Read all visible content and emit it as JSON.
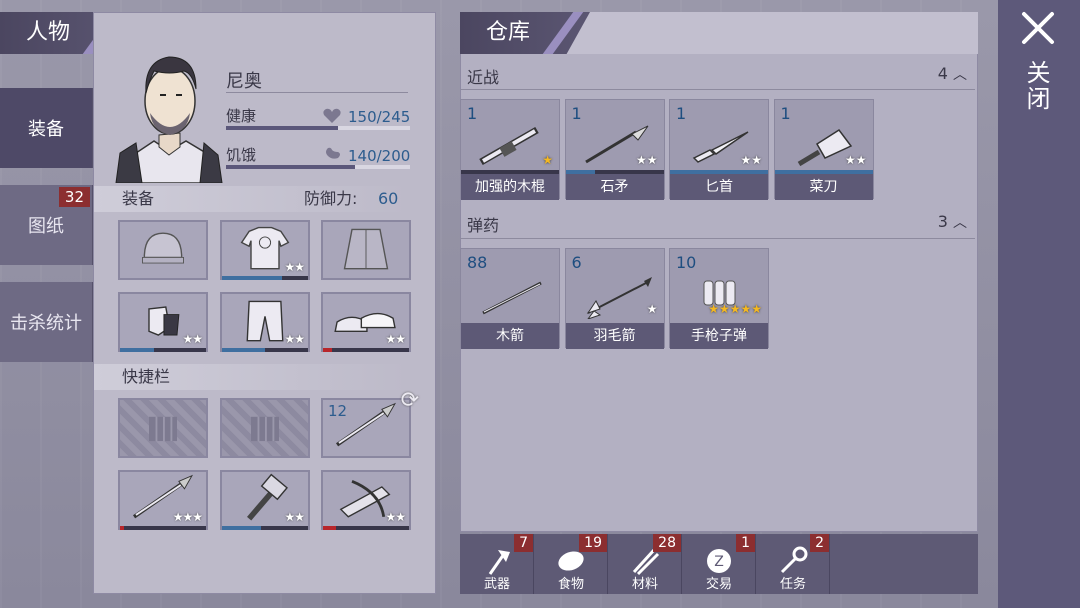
{
  "left_nav": {
    "title": "人物",
    "items": [
      {
        "label": "装备",
        "active": true
      },
      {
        "label": "图纸",
        "badge": "32"
      },
      {
        "label": "击杀统计"
      }
    ]
  },
  "character": {
    "name": "尼奥",
    "health_label": "健康",
    "health_value": "150/245",
    "health_fraction": 0.61,
    "hunger_label": "饥饿",
    "hunger_value": "140/200",
    "hunger_fraction": 0.7,
    "equipment_label": "装备",
    "defense_label": "防御力:",
    "defense_value": "60",
    "quickbar_label": "快捷栏",
    "equipment_slots": [
      {
        "icon": "beanie-icon",
        "stars": ""
      },
      {
        "icon": "shirt-icon",
        "stars": "★★",
        "durability": 0.7,
        "dur_color": "#3f6fa0"
      },
      {
        "icon": "jacket-icon",
        "stars": ""
      },
      {
        "icon": "gloves-icon",
        "stars": "★★",
        "durability": 0.4,
        "dur_color": "#3f6fa0"
      },
      {
        "icon": "pants-icon",
        "stars": "★★",
        "durability": 0.5,
        "dur_color": "#3f6fa0"
      },
      {
        "icon": "shoes-icon",
        "stars": "★★",
        "durability": 0.1,
        "dur_color": "#b8262b"
      }
    ],
    "quick_slots": [
      {
        "icon": "locked-icon",
        "locked": true
      },
      {
        "icon": "locked-icon",
        "locked": true
      },
      {
        "icon": "spear-icon",
        "count": "12",
        "refresh": true
      },
      {
        "icon": "spear-icon",
        "stars": "★★★",
        "durability": 0.05,
        "dur_color": "#b8262b"
      },
      {
        "icon": "hammer-icon",
        "stars": "★★",
        "durability": 0.45,
        "dur_color": "#3f6fa0"
      },
      {
        "icon": "crossbow-icon",
        "stars": "★★",
        "durability": 0.15,
        "dur_color": "#b8262b"
      }
    ]
  },
  "storage": {
    "title": "仓库",
    "categories": [
      {
        "name": "近战",
        "count": "4",
        "items": [
          {
            "count": "1",
            "label": "加强的木棍",
            "stars": "★",
            "gold": true,
            "durability": 0.0,
            "icon": "reinforced-club-icon"
          },
          {
            "count": "1",
            "label": "石矛",
            "stars": "★★",
            "durability": 0.3,
            "icon": "stone-spear-icon"
          },
          {
            "count": "1",
            "label": "匕首",
            "stars": "★★",
            "durability": 1.0,
            "icon": "dagger-icon"
          },
          {
            "count": "1",
            "label": "菜刀",
            "stars": "★★",
            "durability": 1.0,
            "icon": "cleaver-icon"
          }
        ]
      },
      {
        "name": "弹药",
        "count": "3",
        "items": [
          {
            "count": "88",
            "label": "木箭",
            "stars": "",
            "icon": "wooden-arrow-icon"
          },
          {
            "count": "6",
            "label": "羽毛箭",
            "stars": "★",
            "icon": "feather-arrow-icon"
          },
          {
            "count": "10",
            "label": "手枪子弹",
            "stars": "★★★★★",
            "gold": true,
            "icon": "pistol-ammo-icon"
          }
        ]
      }
    ]
  },
  "tabs": [
    {
      "label": "武器",
      "badge": "7",
      "icon": "axe-icon"
    },
    {
      "label": "食物",
      "badge": "19",
      "icon": "meat-icon"
    },
    {
      "label": "材料",
      "badge": "28",
      "icon": "materials-icon"
    },
    {
      "label": "交易",
      "badge": "1",
      "icon": "trade-coin-icon"
    },
    {
      "label": "任务",
      "badge": "2",
      "icon": "key-icon"
    }
  ],
  "close": {
    "label": "关闭"
  }
}
